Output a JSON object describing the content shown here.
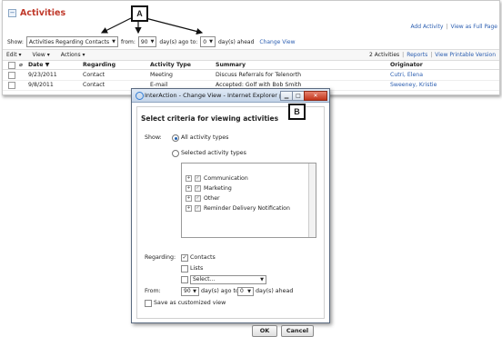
{
  "panel": {
    "title": "Activities",
    "links": [
      "Add Activity",
      "View as Full Page"
    ],
    "filters": {
      "show_label": "Show:",
      "show_value": "Activities Regarding Contacts",
      "from_label": "from:",
      "from_value": "90",
      "ago_label": "day(s) ago to:",
      "to_value": "0",
      "ahead_label": "day(s) ahead",
      "change_view": "Change View"
    },
    "toolbar": {
      "edit": "Edit",
      "view": "View",
      "actions": "Actions",
      "count": "2 Activities",
      "reports": "Reports",
      "printable": "View Printable Version"
    },
    "columns": [
      "Date ▼",
      "Regarding",
      "Activity Type",
      "Summary",
      "Originator"
    ],
    "rows": [
      {
        "date": "9/23/2011",
        "regarding": "Contact",
        "type": "Meeting",
        "summary": "Discuss Referrals for Telenorth",
        "originator": "Cutri, Elena"
      },
      {
        "date": "9/8/2011",
        "regarding": "Contact",
        "type": "E-mail",
        "summary": "Accepted: Golf with Bob Smith",
        "originator": "Sweeney, Kristie"
      }
    ]
  },
  "callouts": {
    "a": "A",
    "b": "B"
  },
  "dialog": {
    "title": "InterAction - Change View - Internet Explorer pr...",
    "heading": "Select criteria for viewing activities",
    "show_label": "Show:",
    "all_types": "All activity types",
    "selected_types": "Selected activity types",
    "types": [
      "Communication",
      "Marketing",
      "Other",
      "Reminder Delivery Notification"
    ],
    "regarding_label": "Regarding:",
    "contacts": "Contacts",
    "lists": "Lists",
    "select_placeholder": "Select...",
    "from_label": "From:",
    "from_value": "90",
    "ago_to": "day(s) ago to",
    "to_value": "0",
    "ahead": "day(s)  ahead",
    "save_view": "Save as customized view",
    "ok": "OK",
    "cancel": "Cancel"
  }
}
